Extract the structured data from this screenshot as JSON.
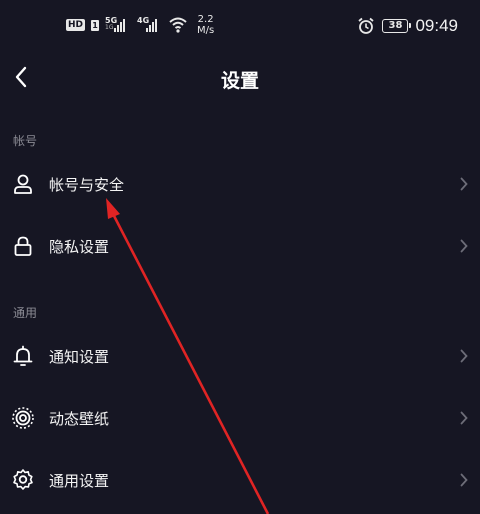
{
  "status_bar": {
    "hd": "HD",
    "sim": "1",
    "net1": {
      "type": "5G",
      "sub": "1G"
    },
    "net2": {
      "type": "4G"
    },
    "speed_value": "2.2",
    "speed_unit": "M/s",
    "battery": "38",
    "time": "09:49"
  },
  "header": {
    "title": "设置",
    "back_icon": "chevron-left-icon"
  },
  "sections": [
    {
      "title": "帐号",
      "items": [
        {
          "label": "帐号与安全",
          "icon": "person-icon"
        },
        {
          "label": "隐私设置",
          "icon": "lock-icon"
        }
      ]
    },
    {
      "title": "通用",
      "items": [
        {
          "label": "通知设置",
          "icon": "bell-icon"
        },
        {
          "label": "动态壁纸",
          "icon": "wallpaper-icon"
        },
        {
          "label": "通用设置",
          "icon": "gear-icon"
        }
      ]
    }
  ],
  "colors": {
    "background": "#161623",
    "text": "#f4f4f4",
    "secondary_text": "#8b8b94",
    "chevron": "#6d6d78",
    "annotation": "#e02424"
  }
}
